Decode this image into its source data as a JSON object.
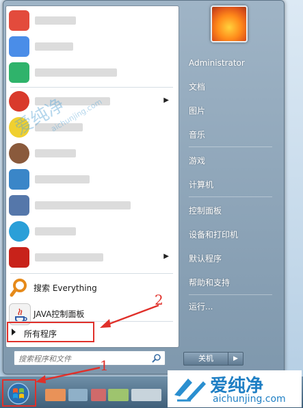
{
  "start_menu": {
    "left_pane": {
      "pinned": [
        {
          "label": "搜索 Everything",
          "icon": "everything-search-icon"
        },
        {
          "label": "JAVA控制面板",
          "icon": "java-icon"
        }
      ],
      "all_programs_label": "所有程序",
      "search": {
        "placeholder": "搜索程序和文件"
      }
    },
    "right_pane": {
      "user": "Administrator",
      "items": [
        "文档",
        "图片",
        "音乐",
        "游戏",
        "计算机",
        "控制面板",
        "设备和打印机",
        "默认程序",
        "帮助和支持",
        "运行..."
      ]
    },
    "shutdown_label": "关机"
  },
  "annotations": {
    "step1": "1",
    "step2": "2"
  },
  "watermark": {
    "text_cn": "爱纯净",
    "text_url": "aichunjing.com"
  },
  "colors": {
    "accent_red": "#e0302a",
    "menu_blue": "#7f98ad"
  }
}
